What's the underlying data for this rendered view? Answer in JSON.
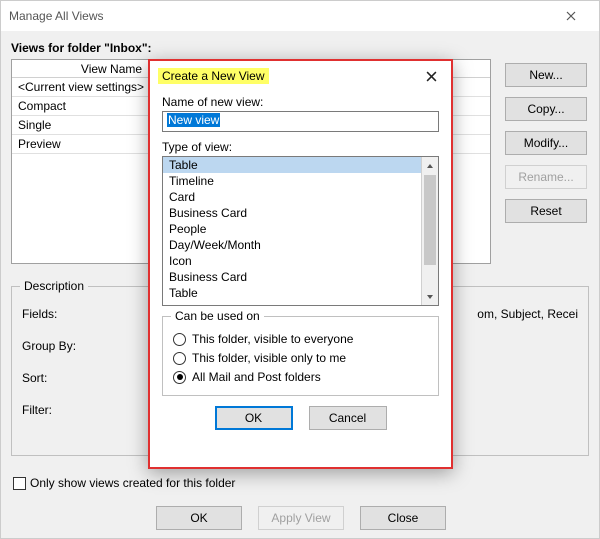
{
  "manage": {
    "title": "Manage All Views",
    "views_for_label": "Views for folder \"Inbox\":",
    "header_view_name": "View Name",
    "rows": [
      {
        "name": "<Current view settings>"
      },
      {
        "name": "Compact"
      },
      {
        "name": "Single"
      },
      {
        "name": "Preview"
      }
    ],
    "buttons": {
      "new": "New...",
      "copy": "Copy...",
      "modify": "Modify...",
      "rename": "Rename...",
      "reset": "Reset"
    },
    "description": {
      "legend": "Description",
      "fields_label": "Fields:",
      "fields_value": "om, Subject, Recei",
      "groupby_label": "Group By:",
      "sort_label": "Sort:",
      "filter_label": "Filter:"
    },
    "only_show_label": "Only show views created for this folder",
    "bottom": {
      "ok": "OK",
      "apply": "Apply View",
      "close": "Close"
    }
  },
  "create": {
    "title": "Create a New View",
    "name_label": "Name of new view:",
    "name_value": "New view",
    "type_label": "Type of view:",
    "types": [
      "Table",
      "Timeline",
      "Card",
      "Business Card",
      "People",
      "Day/Week/Month",
      "Icon",
      "Business Card",
      "Table"
    ],
    "selected_type_index": 0,
    "usedon": {
      "legend": "Can be used on",
      "opt1": "This folder, visible to everyone",
      "opt2": "This folder, visible only to me",
      "opt3": "All Mail and Post folders",
      "selected": 3
    },
    "buttons": {
      "ok": "OK",
      "cancel": "Cancel"
    }
  }
}
